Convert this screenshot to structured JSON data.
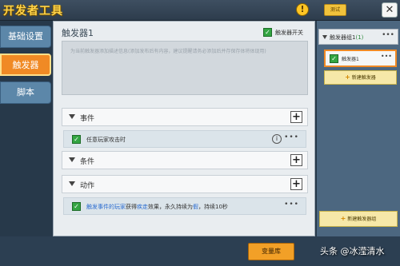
{
  "app": {
    "title": "开发者工具",
    "warn_icon": "exclamation-icon",
    "test_label": "测试",
    "close_label": "✕"
  },
  "nav": {
    "items": [
      {
        "label": "基础设置",
        "active": false
      },
      {
        "label": "触发器",
        "active": true
      },
      {
        "label": "脚本",
        "active": false
      }
    ]
  },
  "main": {
    "trigger_name": "触发器1",
    "switch_label": "触发器开关",
    "description_placeholder": "为当前触发器添加描述信息(添加发布后有内容，建议提醒请务必添加后并存保存体将体现用)",
    "sections": {
      "event": {
        "label": "事件"
      },
      "condition": {
        "label": "条件"
      },
      "action": {
        "label": "动作"
      }
    },
    "event_entry": {
      "text": "任意玩家攻击时",
      "info": "i",
      "more": "•••"
    },
    "action_entry": {
      "part1": "触发事件的玩家",
      "part2": "获得",
      "part3": "疾走",
      "part4": "效果，永久持续为",
      "part5": "假",
      "part6": "，持续10秒",
      "more": "•••"
    }
  },
  "right": {
    "group_label": "触发器组1",
    "group_count": "(1)",
    "group_more": "•••",
    "trigger_label": "触发器1",
    "trigger_more": "•••",
    "new_trigger": "新建触发器",
    "new_group": "新建触发器组"
  },
  "bottom": {
    "library_button": "变量库",
    "watermark": "头条 @冰滢清水"
  },
  "colors": {
    "accent": "#f08a25",
    "nav": "#5c87a9",
    "check": "#33a542",
    "title": "#ffd44a"
  }
}
